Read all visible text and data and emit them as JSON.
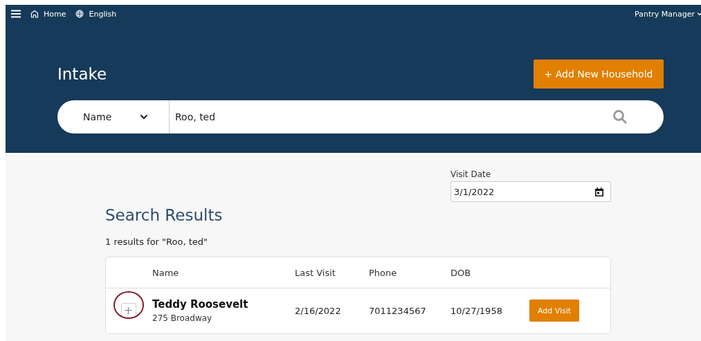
{
  "nav": {
    "home": "Home",
    "language": "English",
    "user": "Pantry Manager"
  },
  "header": {
    "title": "Intake",
    "add_button": "+ Add New Household",
    "search": {
      "field": "Name",
      "value": "Roo, ted"
    }
  },
  "visit_date": {
    "label": "Visit Date",
    "value": "3/1/2022"
  },
  "results": {
    "title": "Search Results",
    "summary": "1 results for \"Roo, ted\"",
    "columns": [
      "Name",
      "Last Visit",
      "Phone",
      "DOB"
    ],
    "rows": [
      {
        "expand": "+",
        "name": "Teddy Roosevelt",
        "address": "275 Broadway",
        "last_visit": "2/16/2022",
        "phone": "7011234567",
        "dob": "10/27/1958",
        "action": "Add Visit",
        "highlighted": true
      }
    ]
  }
}
